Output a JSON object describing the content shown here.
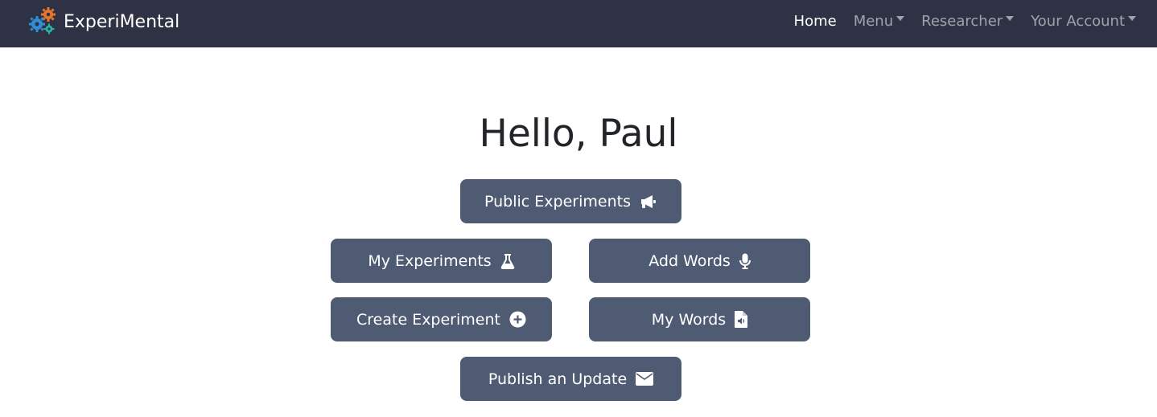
{
  "navbar": {
    "brand": "ExperiMental",
    "links": [
      {
        "label": "Home",
        "active": true,
        "dropdown": false
      },
      {
        "label": "Menu",
        "active": false,
        "dropdown": true
      },
      {
        "label": "Researcher",
        "active": false,
        "dropdown": true
      },
      {
        "label": "Your Account",
        "active": false,
        "dropdown": true
      }
    ]
  },
  "main": {
    "greeting": "Hello, Paul",
    "buttons": {
      "public_experiments": {
        "label": "Public Experiments",
        "icon": "megaphone-icon"
      },
      "my_experiments": {
        "label": "My Experiments",
        "icon": "flask-icon"
      },
      "add_words": {
        "label": "Add Words",
        "icon": "microphone-icon"
      },
      "create_experiment": {
        "label": "Create Experiment",
        "icon": "plus-circle-icon"
      },
      "my_words": {
        "label": "My Words",
        "icon": "audio-file-icon"
      },
      "publish_update": {
        "label": "Publish an Update",
        "icon": "envelope-icon"
      }
    }
  },
  "colors": {
    "navbar_bg": "#2e3244",
    "button_bg": "#4f5b73",
    "text": "#212529",
    "nav_inactive": "rgba(255,255,255,0.55)"
  }
}
